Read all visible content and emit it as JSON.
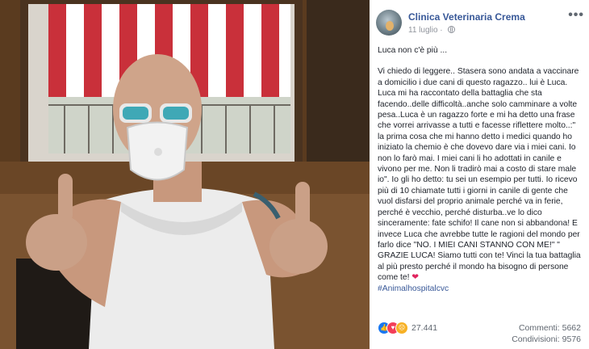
{
  "post": {
    "page_name": "Clinica Veterinaria Crema",
    "date": "11 luglio",
    "more_icon": "more-dots-icon",
    "privacy_icon": "globe-icon",
    "title_line": "Luca non c'è più ...",
    "body": "Vi chiedo di leggere.. Stasera sono andata a vaccinare a domicilio i due cani di questo ragazzo.. lui è Luca. Luca mi ha raccontato della battaglia che sta facendo..delle difficoltà..anche solo camminare a volte pesa..Luca è un ragazzo forte e mi ha detto una frase che vorrei arrivasse a tutti e facesse riflettere molto..:\" la prima cosa che mi hanno detto i medici quando ho iniziato la chemio è che dovevo dare via i miei cani. Io non lo farò mai. I miei cani li ho adottati in canile e vivono per me. Non li tradirò mai a costo di stare male io\". Io gli ho detto: tu sei un esempio per tutti. Io ricevo più di 10 chiamate tutti i giorni in canile di gente che vuol disfarsi del proprio animale perché va in ferie, perché è vecchio, perché disturba..ve lo dico sinceramente: fate schifo! Il cane non si abbandona! E invece Luca che avrebbe tutte le ragioni del mondo per farlo dice \"NO. I MIEI CANI STANNO CON ME!\" \" GRAZIE LUCA! Siamo tutti con te! Vinci la tua battaglia al più presto perché il mondo ha bisogno di persone come te!",
    "heart_emoji": "❤",
    "hashtag": "#Animalhospitalcvc"
  },
  "reactions": {
    "icons": [
      "like-icon",
      "love-icon",
      "sad-icon"
    ],
    "count": "27.441"
  },
  "stats": {
    "comments": "Commenti: 5662",
    "shares": "Condivisioni: 9576"
  },
  "colors": {
    "link": "#385898",
    "text": "#1d2129",
    "meta": "#90949c",
    "like": "#1877f2",
    "love": "#f33e58",
    "sad": "#f7b125"
  }
}
